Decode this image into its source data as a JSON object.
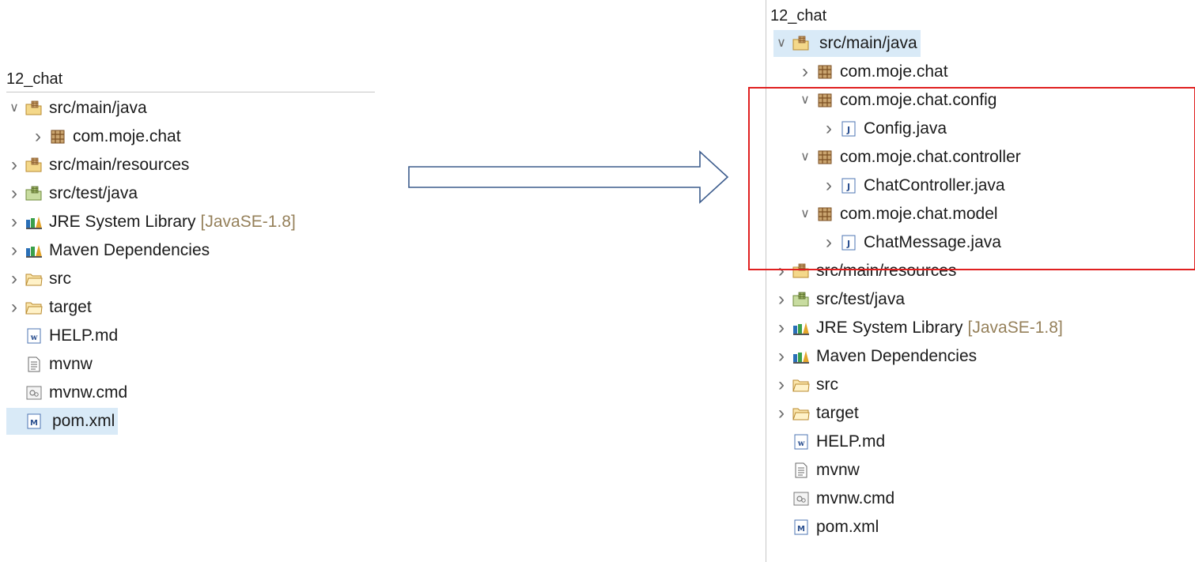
{
  "left": {
    "title": "12_chat",
    "rows": [
      {
        "label": "src/main/java",
        "icon": "source-folder-icon",
        "toggle": "expanded",
        "level": 0,
        "selected": false
      },
      {
        "label": "com.moje.chat",
        "icon": "package-icon",
        "toggle": "collapsed",
        "level": 1,
        "selected": false
      },
      {
        "label": "src/main/resources",
        "icon": "source-folder-icon",
        "toggle": "collapsed",
        "level": 0,
        "selected": false
      },
      {
        "label": "src/test/java",
        "icon": "test-source-folder-icon",
        "toggle": "collapsed",
        "level": 0,
        "selected": false
      },
      {
        "label": "JRE System Library",
        "decoration": "[JavaSE-1.8]",
        "icon": "library-icon",
        "toggle": "collapsed",
        "level": 0,
        "selected": false
      },
      {
        "label": "Maven Dependencies",
        "icon": "library-icon",
        "toggle": "collapsed",
        "level": 0,
        "selected": false
      },
      {
        "label": "src",
        "icon": "folder-icon",
        "toggle": "collapsed",
        "level": 0,
        "selected": false
      },
      {
        "label": "target",
        "icon": "folder-icon",
        "toggle": "collapsed",
        "level": 0,
        "selected": false
      },
      {
        "label": "HELP.md",
        "icon": "word-file-icon",
        "toggle": "none",
        "level": 0,
        "selected": false
      },
      {
        "label": "mvnw",
        "icon": "text-file-icon",
        "toggle": "none",
        "level": 0,
        "selected": false
      },
      {
        "label": "mvnw.cmd",
        "icon": "cmd-file-icon",
        "toggle": "none",
        "level": 0,
        "selected": false
      },
      {
        "label": "pom.xml",
        "icon": "maven-file-icon",
        "toggle": "none",
        "level": 0,
        "selected": true
      }
    ]
  },
  "right": {
    "title": "12_chat",
    "rows": [
      {
        "label": "src/main/java",
        "icon": "source-folder-icon",
        "toggle": "expanded",
        "level": 0,
        "selected": true
      },
      {
        "label": "com.moje.chat",
        "icon": "package-icon",
        "toggle": "collapsed",
        "level": 1,
        "selected": false
      },
      {
        "label": "com.moje.chat.config",
        "icon": "package-icon",
        "toggle": "expanded",
        "level": 1,
        "selected": false
      },
      {
        "label": "Config.java",
        "icon": "java-file-icon",
        "toggle": "collapsed",
        "level": 2,
        "selected": false
      },
      {
        "label": "com.moje.chat.controller",
        "icon": "package-icon",
        "toggle": "expanded",
        "level": 1,
        "selected": false
      },
      {
        "label": "ChatController.java",
        "icon": "java-file-icon",
        "toggle": "collapsed",
        "level": 2,
        "selected": false
      },
      {
        "label": "com.moje.chat.model",
        "icon": "package-icon",
        "toggle": "expanded",
        "level": 1,
        "selected": false
      },
      {
        "label": "ChatMessage.java",
        "icon": "java-file-icon",
        "toggle": "collapsed",
        "level": 2,
        "selected": false
      },
      {
        "label": "src/main/resources",
        "icon": "source-folder-icon",
        "toggle": "collapsed",
        "level": 0,
        "selected": false
      },
      {
        "label": "src/test/java",
        "icon": "test-source-folder-icon",
        "toggle": "collapsed",
        "level": 0,
        "selected": false
      },
      {
        "label": "JRE System Library",
        "decoration": "[JavaSE-1.8]",
        "icon": "library-icon",
        "toggle": "collapsed",
        "level": 0,
        "selected": false
      },
      {
        "label": "Maven Dependencies",
        "icon": "library-icon",
        "toggle": "collapsed",
        "level": 0,
        "selected": false
      },
      {
        "label": "src",
        "icon": "folder-icon",
        "toggle": "collapsed",
        "level": 0,
        "selected": false
      },
      {
        "label": "target",
        "icon": "folder-icon",
        "toggle": "collapsed",
        "level": 0,
        "selected": false
      },
      {
        "label": "HELP.md",
        "icon": "word-file-icon",
        "toggle": "none",
        "level": 0,
        "selected": false
      },
      {
        "label": "mvnw",
        "icon": "text-file-icon",
        "toggle": "none",
        "level": 0,
        "selected": false
      },
      {
        "label": "mvnw.cmd",
        "icon": "cmd-file-icon",
        "toggle": "none",
        "level": 0,
        "selected": false
      },
      {
        "label": "pom.xml",
        "icon": "maven-file-icon",
        "toggle": "none",
        "level": 0,
        "selected": false
      }
    ]
  },
  "colors": {
    "highlight_box": "#e02020",
    "selection": "#d9eaf7",
    "decoration_text": "#95805a",
    "arrow": "#3b5b8c"
  }
}
